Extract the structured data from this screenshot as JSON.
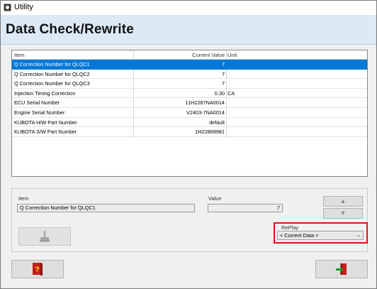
{
  "window": {
    "title": "Utility"
  },
  "header": {
    "heading": "Data Check/Rewrite"
  },
  "grid": {
    "columns": {
      "item": "Item",
      "value": "Current Value",
      "unit": "Unit"
    },
    "rows": [
      {
        "item": "Q Correction Number for QLQC1",
        "value": "7",
        "unit": "",
        "selected": true
      },
      {
        "item": "Q Correction Number for QLQC2",
        "value": "7",
        "unit": ""
      },
      {
        "item": "Q Correction Number for QLQC3",
        "value": "7",
        "unit": ""
      },
      {
        "item": "Injection Timing Correction",
        "value": "0.30",
        "unit": "CA"
      },
      {
        "item": "ECU Serial Number",
        "value": "11H2287NA0014",
        "unit": ""
      },
      {
        "item": "Engine Serial Number",
        "value": "V2403-7NA0014",
        "unit": ""
      },
      {
        "item": "KUBOTA H/W Part Number",
        "value": "default",
        "unit": ""
      },
      {
        "item": "KUBOTA S/W Part Number",
        "value": "1H22869981",
        "unit": ""
      }
    ]
  },
  "edit": {
    "item_label": "Item",
    "item_value": "Q Correction Number for QLQC1",
    "value_label": "Value",
    "value_value": "7"
  },
  "replay": {
    "label": "RePlay",
    "selected": "< Current Data >"
  },
  "colors": {
    "selection": "#0078d7",
    "highlight_box": "#e0101a",
    "header_band": "#dde9f5"
  },
  "icons": {
    "up": "triangle-up-icon",
    "down": "triangle-down-icon",
    "write": "joystick-icon",
    "help": "help-book-icon",
    "exit": "exit-door-icon"
  }
}
